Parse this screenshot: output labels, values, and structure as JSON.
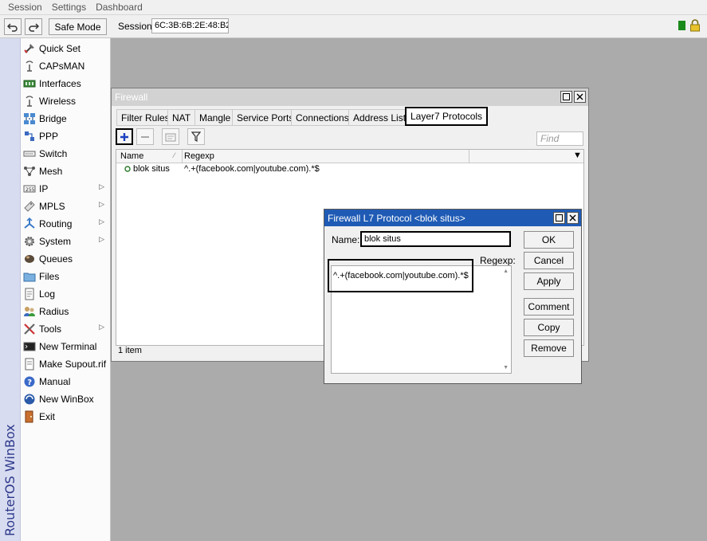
{
  "menu": [
    "Session",
    "Settings",
    "Dashboard"
  ],
  "toolbar": {
    "undo_icon": "undo-icon",
    "redo_icon": "redo-icon",
    "safe_mode_label": "Safe Mode",
    "session_label": "Session:",
    "session_value": "6C:3B:6B:2E:48:B2"
  },
  "brand": "RouterOS WinBox",
  "sidebar": {
    "items": [
      {
        "label": "Quick Set",
        "icon": "quick-set-icon",
        "submenu": false
      },
      {
        "label": "CAPsMAN",
        "icon": "capsman-icon",
        "submenu": false
      },
      {
        "label": "Interfaces",
        "icon": "interfaces-icon",
        "submenu": false
      },
      {
        "label": "Wireless",
        "icon": "wireless-icon",
        "submenu": false
      },
      {
        "label": "Bridge",
        "icon": "bridge-icon",
        "submenu": false
      },
      {
        "label": "PPP",
        "icon": "ppp-icon",
        "submenu": false
      },
      {
        "label": "Switch",
        "icon": "switch-icon",
        "submenu": false
      },
      {
        "label": "Mesh",
        "icon": "mesh-icon",
        "submenu": false
      },
      {
        "label": "IP",
        "icon": "ip-icon",
        "submenu": true
      },
      {
        "label": "MPLS",
        "icon": "mpls-icon",
        "submenu": true
      },
      {
        "label": "Routing",
        "icon": "routing-icon",
        "submenu": true
      },
      {
        "label": "System",
        "icon": "system-icon",
        "submenu": true
      },
      {
        "label": "Queues",
        "icon": "queues-icon",
        "submenu": false
      },
      {
        "label": "Files",
        "icon": "files-icon",
        "submenu": false
      },
      {
        "label": "Log",
        "icon": "log-icon",
        "submenu": false
      },
      {
        "label": "Radius",
        "icon": "radius-icon",
        "submenu": false
      },
      {
        "label": "Tools",
        "icon": "tools-icon",
        "submenu": true
      },
      {
        "label": "New Terminal",
        "icon": "terminal-icon",
        "submenu": false
      },
      {
        "label": "Make Supout.rif",
        "icon": "supout-icon",
        "submenu": false
      },
      {
        "label": "Manual",
        "icon": "manual-icon",
        "submenu": false
      },
      {
        "label": "New WinBox",
        "icon": "winbox-icon",
        "submenu": false
      },
      {
        "label": "Exit",
        "icon": "exit-icon",
        "submenu": false
      }
    ]
  },
  "firewall": {
    "title": "Firewall",
    "tabs": [
      "Filter Rules",
      "NAT",
      "Mangle",
      "Service Ports",
      "Connections",
      "Address Lists",
      "Layer7 Protocols"
    ],
    "active_tab": "Layer7 Protocols",
    "find_placeholder": "Find",
    "columns": [
      "Name",
      "Regexp"
    ],
    "rows": [
      {
        "name": "blok situs",
        "regexp": "^.+(facebook.com|youtube.com).*$"
      }
    ],
    "status": "1 item"
  },
  "dialog": {
    "title": "Firewall L7 Protocol <blok situs>",
    "name_label": "Name:",
    "name_value": "blok situs",
    "regexp_label": "Regexp:",
    "regexp_value": "^.+(facebook.com|youtube.com).*$",
    "buttons": {
      "ok": "OK",
      "cancel": "Cancel",
      "apply": "Apply",
      "comment": "Comment",
      "copy": "Copy",
      "remove": "Remove"
    }
  },
  "colors": {
    "background": "#ababab",
    "brand_strip": "#d8dcf0",
    "brand_text": "#2e3a8c",
    "dialog_title_bg": "#1f5bb5",
    "status_green": "#1a8a1a",
    "add_icon": "#1a3fc0"
  }
}
